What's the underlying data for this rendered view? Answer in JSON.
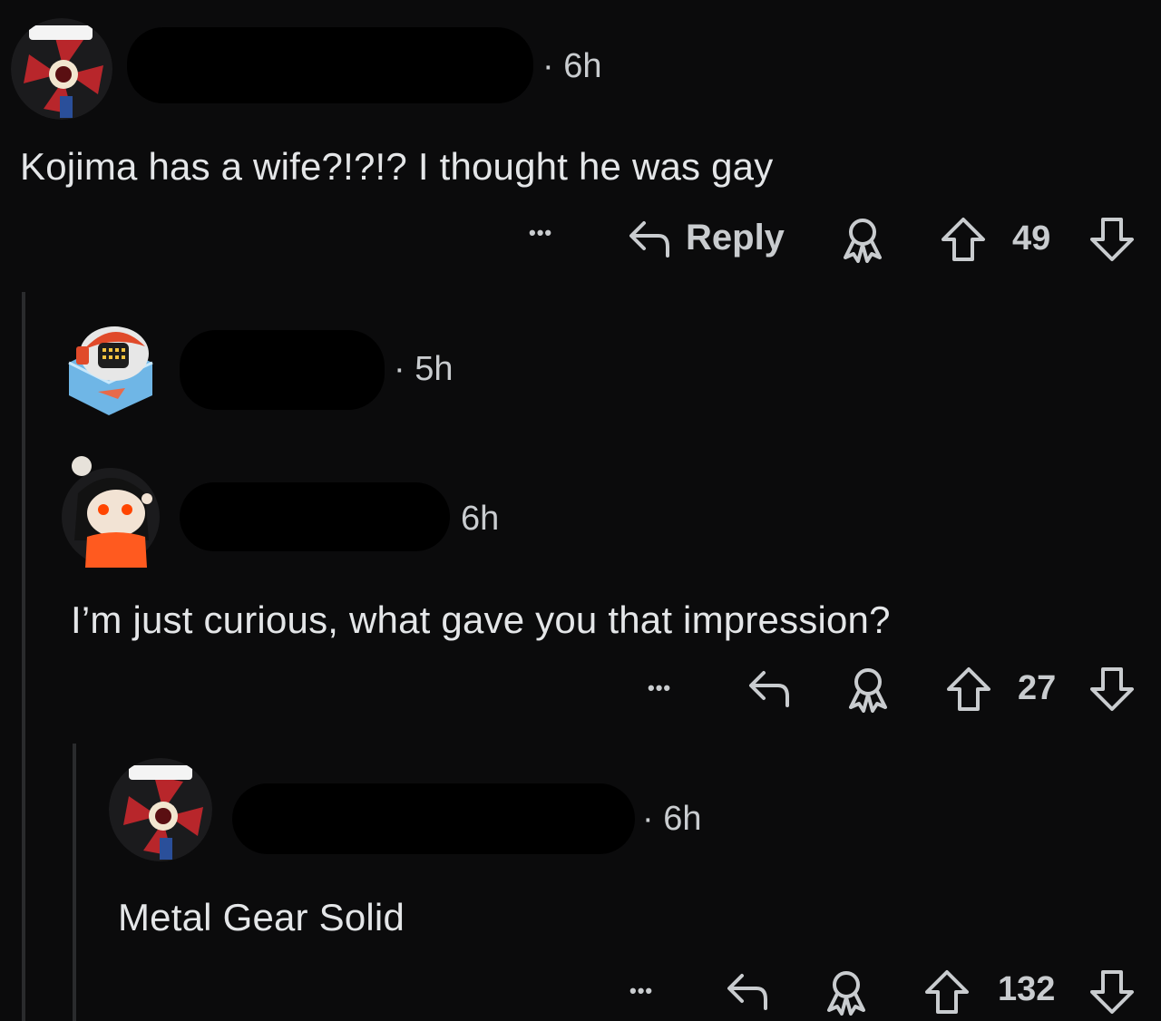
{
  "comments": [
    {
      "time": "· 6h",
      "body": "Kojima has a wife?!?!? I thought he was gay",
      "actions": {
        "more": "•••",
        "reply_label": "Reply",
        "score": "49"
      }
    },
    {
      "time": "· 5h"
    },
    {
      "time": "6h",
      "body": "I’m just curious, what gave you that impression?",
      "actions": {
        "more": "•••",
        "score": "27"
      }
    },
    {
      "time": "· 6h",
      "body": "Metal Gear Solid",
      "actions": {
        "more": "•••",
        "score": "132"
      }
    }
  ],
  "icons": {
    "reply": "reply-arrow-icon",
    "award": "award-icon",
    "upvote": "upvote-arrow-icon",
    "downvote": "downvote-arrow-icon",
    "more": "more-dots-icon"
  },
  "colors": {
    "background": "#0b0b0c",
    "text": "#e4e6e8",
    "meta": "#c9cccf",
    "thread_line": "#2a2b2d",
    "redaction": "#000000"
  }
}
